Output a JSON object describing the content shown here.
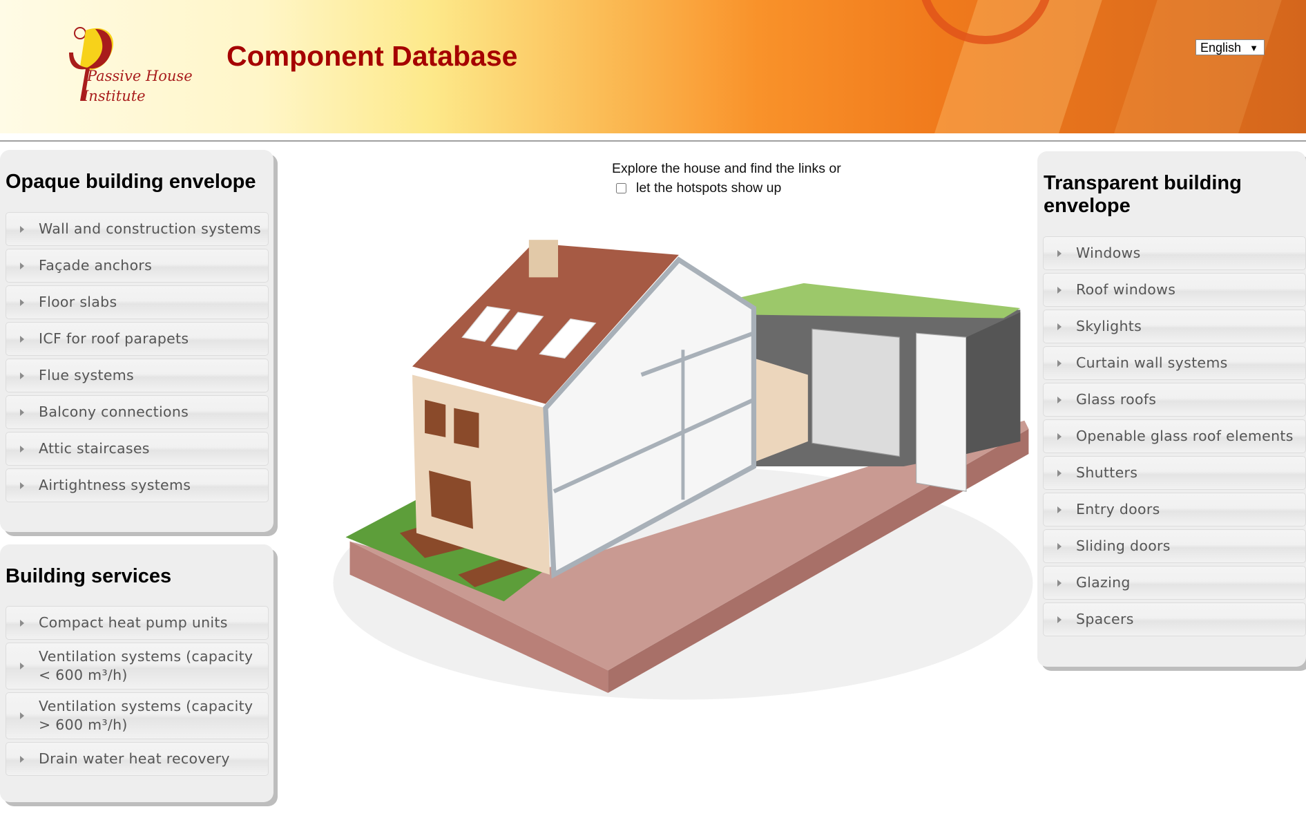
{
  "header": {
    "logo_text_line1": "Passive House",
    "logo_text_line2": "Institute",
    "title": "Component Database",
    "language": {
      "selected": "English",
      "icon": "dropdown-triangle-icon"
    },
    "colors": {
      "title": "#a50000",
      "gradient_start": "#fffbe6",
      "gradient_end": "#d4661c"
    }
  },
  "intro": {
    "line1": "Explore the house and find the links or",
    "checkbox_label": "let the hotspots show up",
    "checkbox_checked": false
  },
  "opaque": {
    "title": "Opaque building envelope",
    "items": [
      {
        "label": "Wall and construction sys­tems"
      },
      {
        "label": "Façade anchors"
      },
      {
        "label": "Floor slabs"
      },
      {
        "label": "ICF for roof parapets"
      },
      {
        "label": "Flue systems"
      },
      {
        "label": "Balcony connections"
      },
      {
        "label": "Attic staircases"
      },
      {
        "label": "Airtightness systems"
      }
    ]
  },
  "services": {
    "title": "Building services",
    "items": [
      {
        "label": "Compact heat pump units"
      },
      {
        "label": "Ventilation systems (capacity < 600 m³/h)"
      },
      {
        "label": "Ventilation systems (capacity > 600 m³/h)"
      },
      {
        "label": "Drain water heat recovery"
      }
    ]
  },
  "transparent": {
    "title": "Transparent building envelope",
    "items": [
      {
        "label": "Windows"
      },
      {
        "label": "Roof windows"
      },
      {
        "label": "Skylights"
      },
      {
        "label": "Curtain wall systems"
      },
      {
        "label": "Glass roofs"
      },
      {
        "label": "Openable glass roof ele­ments"
      },
      {
        "label": "Shutters"
      },
      {
        "label": "Entry doors"
      },
      {
        "label": "Sliding doors"
      },
      {
        "label": "Glazing"
      },
      {
        "label": "Spacers"
      }
    ]
  }
}
